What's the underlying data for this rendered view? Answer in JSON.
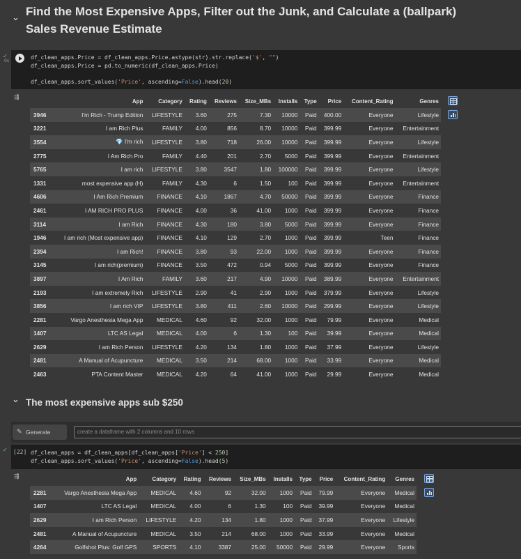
{
  "section1": {
    "title": "Find the Most Expensive Apps, Filter out the Junk, and Calculate a (ballpark) Sales Revenue Estimate"
  },
  "cell1": {
    "code_lines": [
      "df_clean_apps.Price = df_clean_apps.Price.astype(str).str.replace('$', \"\")",
      "df_clean_apps.Price = pd.to_numeric(df_clean_apps.Price)",
      "",
      "df_clean_apps.sort_values('Price', ascending=False).head(20)"
    ]
  },
  "table1": {
    "columns": [
      "",
      "App",
      "Category",
      "Rating",
      "Reviews",
      "Size_MBs",
      "Installs",
      "Type",
      "Price",
      "Content_Rating",
      "Genres"
    ],
    "rows": [
      [
        "3946",
        "I'm Rich - Trump Edition",
        "LIFESTYLE",
        "3.60",
        "275",
        "7.30",
        "10000",
        "Paid",
        "400.00",
        "Everyone",
        "Lifestyle"
      ],
      [
        "3221",
        "I am Rich Plus",
        "FAMILY",
        "4.00",
        "856",
        "8.70",
        "10000",
        "Paid",
        "399.99",
        "Everyone",
        "Entertainment"
      ],
      [
        "3554",
        "💎 I'm rich",
        "LIFESTYLE",
        "3.80",
        "718",
        "26.00",
        "10000",
        "Paid",
        "399.99",
        "Everyone",
        "Lifestyle"
      ],
      [
        "2775",
        "I Am Rich Pro",
        "FAMILY",
        "4.40",
        "201",
        "2.70",
        "5000",
        "Paid",
        "399.99",
        "Everyone",
        "Entertainment"
      ],
      [
        "5765",
        "I am rich",
        "LIFESTYLE",
        "3.80",
        "3547",
        "1.80",
        "100000",
        "Paid",
        "399.99",
        "Everyone",
        "Lifestyle"
      ],
      [
        "1331",
        "most expensive app (H)",
        "FAMILY",
        "4.30",
        "6",
        "1.50",
        "100",
        "Paid",
        "399.99",
        "Everyone",
        "Entertainment"
      ],
      [
        "4606",
        "I Am Rich Premium",
        "FINANCE",
        "4.10",
        "1867",
        "4.70",
        "50000",
        "Paid",
        "399.99",
        "Everyone",
        "Finance"
      ],
      [
        "2461",
        "I AM RICH PRO PLUS",
        "FINANCE",
        "4.00",
        "36",
        "41.00",
        "1000",
        "Paid",
        "399.99",
        "Everyone",
        "Finance"
      ],
      [
        "3114",
        "I am Rich",
        "FINANCE",
        "4.30",
        "180",
        "3.80",
        "5000",
        "Paid",
        "399.99",
        "Everyone",
        "Finance"
      ],
      [
        "1946",
        "I am rich (Most expensive app)",
        "FINANCE",
        "4.10",
        "129",
        "2.70",
        "1000",
        "Paid",
        "399.99",
        "Teen",
        "Finance"
      ],
      [
        "2394",
        "I am Rich!",
        "FINANCE",
        "3.80",
        "93",
        "22.00",
        "1000",
        "Paid",
        "399.99",
        "Everyone",
        "Finance"
      ],
      [
        "3145",
        "I am rich(premium)",
        "FINANCE",
        "3.50",
        "472",
        "0.94",
        "5000",
        "Paid",
        "399.99",
        "Everyone",
        "Finance"
      ],
      [
        "3897",
        "I Am Rich",
        "FAMILY",
        "3.60",
        "217",
        "4.90",
        "10000",
        "Paid",
        "389.99",
        "Everyone",
        "Entertainment"
      ],
      [
        "2193",
        "I am extremely Rich",
        "LIFESTYLE",
        "2.90",
        "41",
        "2.90",
        "1000",
        "Paid",
        "379.99",
        "Everyone",
        "Lifestyle"
      ],
      [
        "3856",
        "I am rich VIP",
        "LIFESTYLE",
        "3.80",
        "411",
        "2.60",
        "10000",
        "Paid",
        "299.99",
        "Everyone",
        "Lifestyle"
      ],
      [
        "2281",
        "Vargo Anesthesia Mega App",
        "MEDICAL",
        "4.60",
        "92",
        "32.00",
        "1000",
        "Paid",
        "79.99",
        "Everyone",
        "Medical"
      ],
      [
        "1407",
        "LTC AS Legal",
        "MEDICAL",
        "4.00",
        "6",
        "1.30",
        "100",
        "Paid",
        "39.99",
        "Everyone",
        "Medical"
      ],
      [
        "2629",
        "I am Rich Person",
        "LIFESTYLE",
        "4.20",
        "134",
        "1.80",
        "1000",
        "Paid",
        "37.99",
        "Everyone",
        "Lifestyle"
      ],
      [
        "2481",
        "A Manual of Acupuncture",
        "MEDICAL",
        "3.50",
        "214",
        "68.00",
        "1000",
        "Paid",
        "33.99",
        "Everyone",
        "Medical"
      ],
      [
        "2463",
        "PTA Content Master",
        "MEDICAL",
        "4.20",
        "64",
        "41.00",
        "1000",
        "Paid",
        "29.99",
        "Everyone",
        "Medical"
      ]
    ]
  },
  "section2": {
    "title": "The most expensive apps sub $250"
  },
  "generate": {
    "button_label": "Generate",
    "placeholder": "create a dataframe with 2 columns and 10 rows"
  },
  "cell2": {
    "exec_count": "[22]",
    "code_lines": [
      "df_clean_apps = df_clean_apps[df_clean_apps['Price'] < 250]",
      "df_clean_apps.sort_values('Price', ascending=False).head(5)"
    ]
  },
  "table2": {
    "columns": [
      "",
      "App",
      "Category",
      "Rating",
      "Reviews",
      "Size_MBs",
      "Installs",
      "Type",
      "Price",
      "Content_Rating",
      "Genres"
    ],
    "rows": [
      [
        "2281",
        "Vargo Anesthesia Mega App",
        "MEDICAL",
        "4.60",
        "92",
        "32.00",
        "1000",
        "Paid",
        "79.99",
        "Everyone",
        "Medical"
      ],
      [
        "1407",
        "LTC AS Legal",
        "MEDICAL",
        "4.00",
        "6",
        "1.30",
        "100",
        "Paid",
        "39.99",
        "Everyone",
        "Medical"
      ],
      [
        "2629",
        "I am Rich Person",
        "LIFESTYLE",
        "4.20",
        "134",
        "1.80",
        "1000",
        "Paid",
        "37.99",
        "Everyone",
        "Lifestyle"
      ],
      [
        "2481",
        "A Manual of Acupuncture",
        "MEDICAL",
        "3.50",
        "214",
        "68.00",
        "1000",
        "Paid",
        "33.99",
        "Everyone",
        "Medical"
      ],
      [
        "4264",
        "Golfshot Plus: Golf GPS",
        "SPORTS",
        "4.10",
        "3387",
        "25.00",
        "50000",
        "Paid",
        "29.99",
        "Everyone",
        "Sports"
      ]
    ]
  },
  "icons": {
    "collapse": "chevron-down-icon",
    "run": "play-circle-icon",
    "output": "output-menu-icon",
    "table_view": "table-grid-icon",
    "chart_suggest": "bar-chart-icon",
    "generate": "sparkle-icon"
  }
}
